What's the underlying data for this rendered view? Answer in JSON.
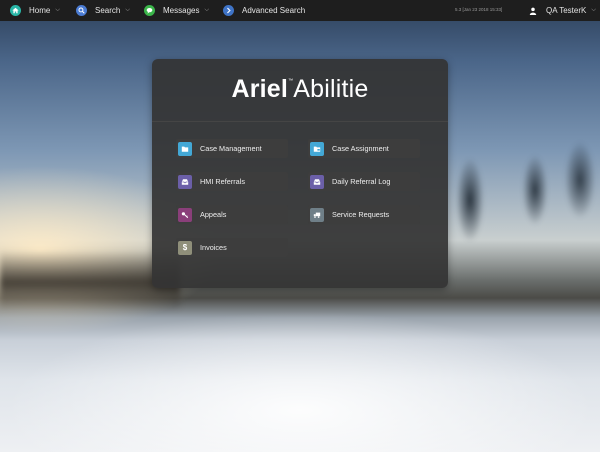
{
  "colors": {
    "navbar_bg": "#1e1e1e",
    "panel_bg": "#343434",
    "home_icon": "#29b6a7",
    "search_icon": "#4a7bd3",
    "messages_icon": "#3bb54a",
    "advanced_icon": "#3f74c7",
    "teal_tile": "#43a8d6",
    "purple_tile": "#6b5fa8",
    "magenta_tile": "#8a3f7a",
    "gray_tile": "#6f7f88",
    "olive_tile": "#8f8f7a"
  },
  "nav": {
    "home": {
      "label": "Home",
      "icon": "home-icon"
    },
    "search": {
      "label": "Search",
      "icon": "search-icon"
    },
    "messages": {
      "label": "Messages",
      "icon": "chat-icon"
    },
    "advanced": {
      "label": "Advanced Search",
      "icon": "chevron-right-icon"
    },
    "version": "5.3 [Jan 23 2018 15:33]",
    "user": {
      "label": "QA TesterK",
      "icon": "user-icon"
    }
  },
  "logo": {
    "bold": "Ariel",
    "tm": "™",
    "thin": "Abilitie"
  },
  "tiles": [
    {
      "label": "Case Management",
      "icon": "folder-icon"
    },
    {
      "label": "Case Assignment",
      "icon": "folder-open-icon"
    },
    {
      "label": "HMI Referrals",
      "icon": "inbox-icon"
    },
    {
      "label": "Daily Referral Log",
      "icon": "inbox-icon"
    },
    {
      "label": "Appeals",
      "icon": "key-icon"
    },
    {
      "label": "Service Requests",
      "icon": "truck-icon"
    },
    {
      "label": "Invoices",
      "icon": "dollar-icon"
    }
  ]
}
